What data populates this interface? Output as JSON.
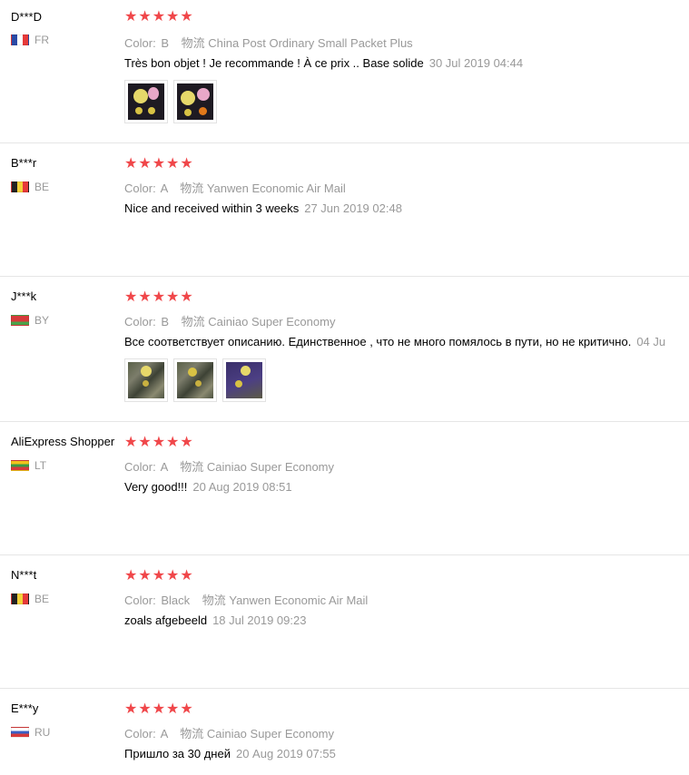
{
  "labels": {
    "color": "Color:",
    "shipping": "物流"
  },
  "reviews": [
    {
      "user": "D***D",
      "country": "FR",
      "color": "B",
      "shipping": "China Post Ordinary Small Packet Plus",
      "feedback": "Très bon objet ! Je recommande ! À ce prix .. Base solide",
      "date": "30 Jul 2019 04:44",
      "rating": "5"
    },
    {
      "user": "B***r",
      "country": "BE",
      "color": "A",
      "shipping": "Yanwen Economic Air Mail",
      "feedback": "Nice and received within 3 weeks",
      "date": "27 Jun 2019 02:48",
      "rating": "5"
    },
    {
      "user": "J***k",
      "country": "BY",
      "color": "B",
      "shipping": "Cainiao Super Economy",
      "feedback": "Все соответствует описанию. Единственное , что не много помялось в пути, но не критично.",
      "date": "04 Ju",
      "rating": "5"
    },
    {
      "user": "AliExpress Shopper",
      "country": "LT",
      "color": "A",
      "shipping": "Cainiao Super Economy",
      "feedback": "Very good!!!",
      "date": "20 Aug 2019 08:51",
      "rating": "5"
    },
    {
      "user": "N***t",
      "country": "BE",
      "color": "Black",
      "shipping": "Yanwen Economic Air Mail",
      "feedback": "zoals afgebeeld",
      "date": "18 Jul 2019 09:23",
      "rating": "5"
    },
    {
      "user": "E***y",
      "country": "RU",
      "color": "A",
      "shipping": "Cainiao Super Economy",
      "feedback": "Пришло за 30 дней",
      "date": "20 Aug 2019 07:55",
      "rating": "5"
    }
  ],
  "colors": {
    "star": "#f0474a",
    "muted": "#999999",
    "divider": "#e6e6e6"
  }
}
